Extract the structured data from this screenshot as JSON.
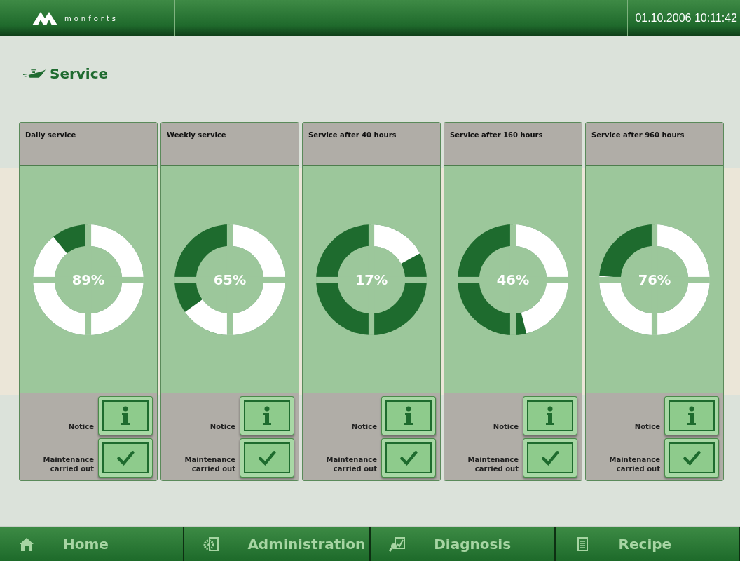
{
  "header": {
    "brand": "monforts",
    "datetime": "01.10.2006 10:11:42"
  },
  "page_title": "Service",
  "services": [
    {
      "title": "Daily service",
      "percent": "89%",
      "notice_label": "Notice",
      "done_label": "Maintenance carried out"
    },
    {
      "title": "Weekly service",
      "percent": "65%",
      "notice_label": "Notice",
      "done_label": "Maintenance carried out"
    },
    {
      "title": "Service after 40 hours",
      "percent": "17%",
      "notice_label": "Notice",
      "done_label": "Maintenance carried out"
    },
    {
      "title": "Service after 160 hours",
      "percent": "46%",
      "notice_label": "Notice",
      "done_label": "Maintenance carried out"
    },
    {
      "title": "Service after 960 hours",
      "percent": "76%",
      "notice_label": "Notice",
      "done_label": "Maintenance carried out"
    }
  ],
  "nav": [
    {
      "label": "Home",
      "kind": "home"
    },
    {
      "label": "Administration",
      "kind": "admin"
    },
    {
      "label": "Diagnosis",
      "kind": "diagnosis"
    },
    {
      "label": "Recipe",
      "kind": "recipe"
    }
  ]
}
